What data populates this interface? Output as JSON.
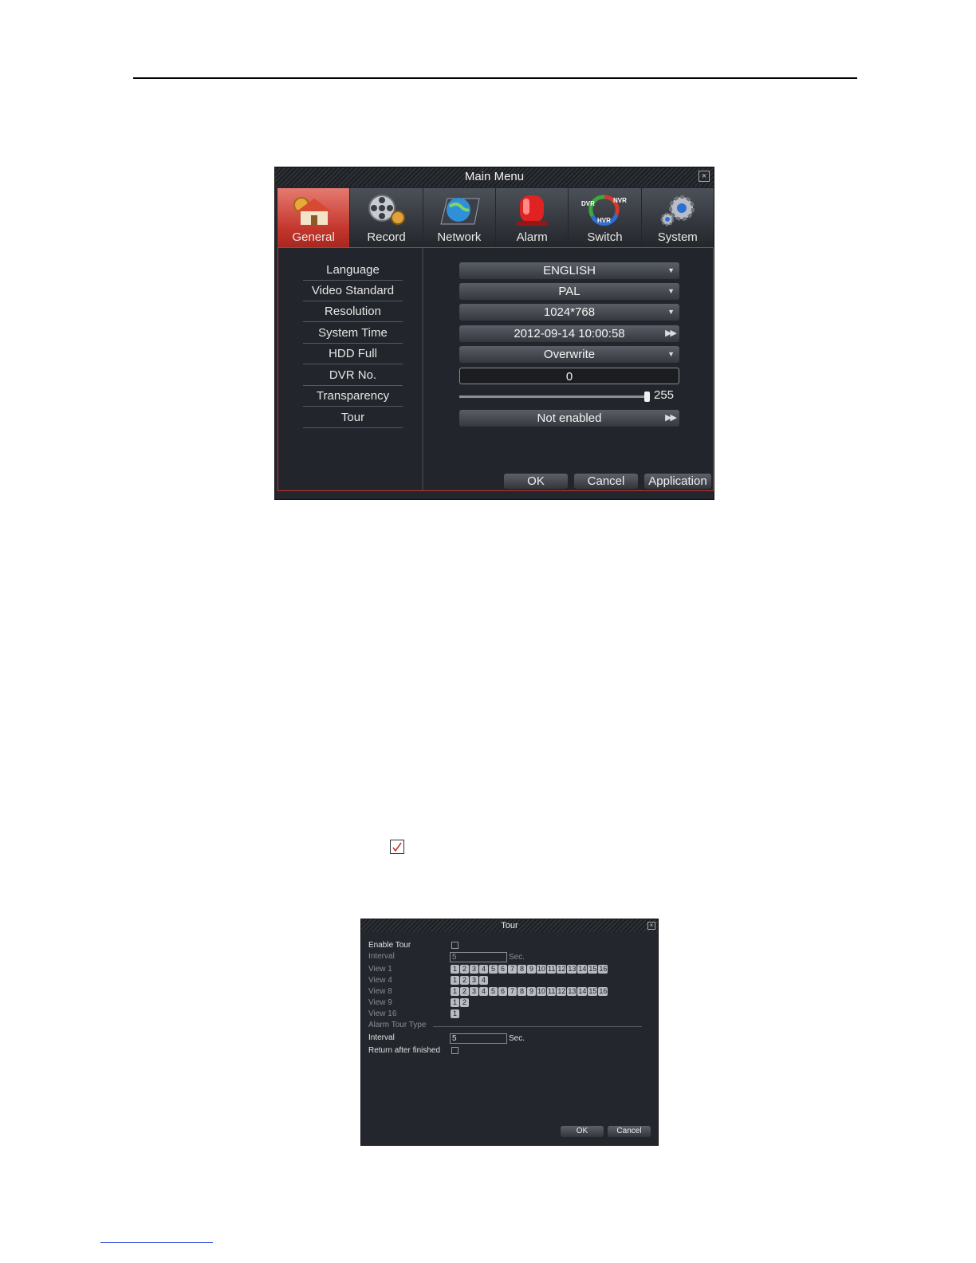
{
  "main_menu": {
    "title": "Main Menu",
    "close_glyph": "×",
    "tabs": [
      {
        "label": "General",
        "icon": "house-gear-icon",
        "active": true
      },
      {
        "label": "Record",
        "icon": "film-reel-icon",
        "active": false
      },
      {
        "label": "Network",
        "icon": "globe-laptop-icon",
        "active": false
      },
      {
        "label": "Alarm",
        "icon": "alarm-siren-icon",
        "active": false
      },
      {
        "label": "Switch",
        "icon": "dvr-nvr-hvr-switch-icon",
        "active": false
      },
      {
        "label": "System",
        "icon": "gears-icon",
        "active": false
      }
    ],
    "switch_icon_text": {
      "dvr": "DVR",
      "nvr": "NVR",
      "hvr": "HVR"
    },
    "rows": [
      {
        "label": "Language",
        "value": "ENGLISH",
        "control": "dropdown"
      },
      {
        "label": "Video Standard",
        "value": "PAL",
        "control": "dropdown"
      },
      {
        "label": "Resolution",
        "value": "1024*768",
        "control": "dropdown"
      },
      {
        "label": "System Time",
        "value": "2012-09-14 10:00:58",
        "control": "forward"
      },
      {
        "label": "HDD Full",
        "value": "Overwrite",
        "control": "dropdown"
      },
      {
        "label": "DVR No.",
        "value": "0",
        "control": "text"
      },
      {
        "label": "Transparency",
        "value": "255",
        "control": "slider",
        "level": 255,
        "max": 255
      },
      {
        "label": "Tour",
        "value": "Not enabled",
        "control": "forward"
      }
    ],
    "glyphs": {
      "dropdown": "▼",
      "forward": "▶▶"
    },
    "buttons": {
      "ok": "OK",
      "cancel": "Cancel",
      "apply": "Application"
    },
    "colors": {
      "active_tab": "#c3352c",
      "window_bg": "#23262c",
      "border_accent": "#c0372e"
    }
  },
  "tour_dialog": {
    "title": "Tour",
    "close_glyph": "×",
    "enable_label": "Enable Tour",
    "interval_label": "Interval",
    "interval_value": "5",
    "sec_label": "Sec.",
    "views": [
      {
        "label": "View 1",
        "numbers": [
          "1",
          "2",
          "3",
          "4",
          "5",
          "6",
          "7",
          "8",
          "9",
          "10",
          "11",
          "12",
          "13",
          "14",
          "15",
          "16"
        ]
      },
      {
        "label": "View 4",
        "numbers": [
          "1",
          "2",
          "3",
          "4"
        ]
      },
      {
        "label": "View 8",
        "numbers": [
          "1",
          "2",
          "3",
          "4",
          "5",
          "6",
          "7",
          "8",
          "9",
          "10",
          "11",
          "12",
          "13",
          "14",
          "15",
          "16"
        ]
      },
      {
        "label": "View 9",
        "numbers": [
          "1",
          "2"
        ]
      },
      {
        "label": "View 16",
        "numbers": [
          "1"
        ]
      }
    ],
    "alarm_tour_type_label": "Alarm Tour Type",
    "alarm_interval_label": "Interval",
    "alarm_interval_value": "5",
    "alarm_sec_label": "Sec.",
    "return_label": "Return after finished",
    "buttons": {
      "ok": "OK",
      "cancel": "Cancel"
    }
  }
}
